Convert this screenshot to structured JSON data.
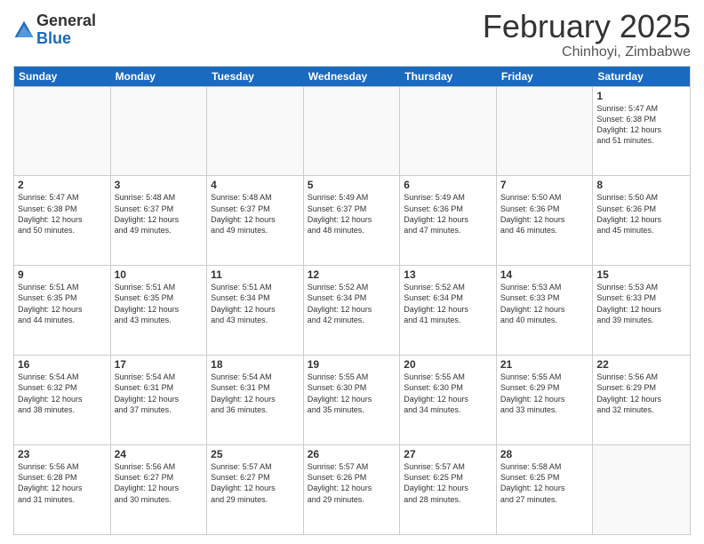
{
  "logo": {
    "general": "General",
    "blue": "Blue"
  },
  "title": "February 2025",
  "location": "Chinhoyi, Zimbabwe",
  "weekdays": [
    "Sunday",
    "Monday",
    "Tuesday",
    "Wednesday",
    "Thursday",
    "Friday",
    "Saturday"
  ],
  "weeks": [
    [
      {
        "day": "",
        "info": ""
      },
      {
        "day": "",
        "info": ""
      },
      {
        "day": "",
        "info": ""
      },
      {
        "day": "",
        "info": ""
      },
      {
        "day": "",
        "info": ""
      },
      {
        "day": "",
        "info": ""
      },
      {
        "day": "1",
        "info": "Sunrise: 5:47 AM\nSunset: 6:38 PM\nDaylight: 12 hours\nand 51 minutes."
      }
    ],
    [
      {
        "day": "2",
        "info": "Sunrise: 5:47 AM\nSunset: 6:38 PM\nDaylight: 12 hours\nand 50 minutes."
      },
      {
        "day": "3",
        "info": "Sunrise: 5:48 AM\nSunset: 6:37 PM\nDaylight: 12 hours\nand 49 minutes."
      },
      {
        "day": "4",
        "info": "Sunrise: 5:48 AM\nSunset: 6:37 PM\nDaylight: 12 hours\nand 49 minutes."
      },
      {
        "day": "5",
        "info": "Sunrise: 5:49 AM\nSunset: 6:37 PM\nDaylight: 12 hours\nand 48 minutes."
      },
      {
        "day": "6",
        "info": "Sunrise: 5:49 AM\nSunset: 6:36 PM\nDaylight: 12 hours\nand 47 minutes."
      },
      {
        "day": "7",
        "info": "Sunrise: 5:50 AM\nSunset: 6:36 PM\nDaylight: 12 hours\nand 46 minutes."
      },
      {
        "day": "8",
        "info": "Sunrise: 5:50 AM\nSunset: 6:36 PM\nDaylight: 12 hours\nand 45 minutes."
      }
    ],
    [
      {
        "day": "9",
        "info": "Sunrise: 5:51 AM\nSunset: 6:35 PM\nDaylight: 12 hours\nand 44 minutes."
      },
      {
        "day": "10",
        "info": "Sunrise: 5:51 AM\nSunset: 6:35 PM\nDaylight: 12 hours\nand 43 minutes."
      },
      {
        "day": "11",
        "info": "Sunrise: 5:51 AM\nSunset: 6:34 PM\nDaylight: 12 hours\nand 43 minutes."
      },
      {
        "day": "12",
        "info": "Sunrise: 5:52 AM\nSunset: 6:34 PM\nDaylight: 12 hours\nand 42 minutes."
      },
      {
        "day": "13",
        "info": "Sunrise: 5:52 AM\nSunset: 6:34 PM\nDaylight: 12 hours\nand 41 minutes."
      },
      {
        "day": "14",
        "info": "Sunrise: 5:53 AM\nSunset: 6:33 PM\nDaylight: 12 hours\nand 40 minutes."
      },
      {
        "day": "15",
        "info": "Sunrise: 5:53 AM\nSunset: 6:33 PM\nDaylight: 12 hours\nand 39 minutes."
      }
    ],
    [
      {
        "day": "16",
        "info": "Sunrise: 5:54 AM\nSunset: 6:32 PM\nDaylight: 12 hours\nand 38 minutes."
      },
      {
        "day": "17",
        "info": "Sunrise: 5:54 AM\nSunset: 6:31 PM\nDaylight: 12 hours\nand 37 minutes."
      },
      {
        "day": "18",
        "info": "Sunrise: 5:54 AM\nSunset: 6:31 PM\nDaylight: 12 hours\nand 36 minutes."
      },
      {
        "day": "19",
        "info": "Sunrise: 5:55 AM\nSunset: 6:30 PM\nDaylight: 12 hours\nand 35 minutes."
      },
      {
        "day": "20",
        "info": "Sunrise: 5:55 AM\nSunset: 6:30 PM\nDaylight: 12 hours\nand 34 minutes."
      },
      {
        "day": "21",
        "info": "Sunrise: 5:55 AM\nSunset: 6:29 PM\nDaylight: 12 hours\nand 33 minutes."
      },
      {
        "day": "22",
        "info": "Sunrise: 5:56 AM\nSunset: 6:29 PM\nDaylight: 12 hours\nand 32 minutes."
      }
    ],
    [
      {
        "day": "23",
        "info": "Sunrise: 5:56 AM\nSunset: 6:28 PM\nDaylight: 12 hours\nand 31 minutes."
      },
      {
        "day": "24",
        "info": "Sunrise: 5:56 AM\nSunset: 6:27 PM\nDaylight: 12 hours\nand 30 minutes."
      },
      {
        "day": "25",
        "info": "Sunrise: 5:57 AM\nSunset: 6:27 PM\nDaylight: 12 hours\nand 29 minutes."
      },
      {
        "day": "26",
        "info": "Sunrise: 5:57 AM\nSunset: 6:26 PM\nDaylight: 12 hours\nand 29 minutes."
      },
      {
        "day": "27",
        "info": "Sunrise: 5:57 AM\nSunset: 6:25 PM\nDaylight: 12 hours\nand 28 minutes."
      },
      {
        "day": "28",
        "info": "Sunrise: 5:58 AM\nSunset: 6:25 PM\nDaylight: 12 hours\nand 27 minutes."
      },
      {
        "day": "",
        "info": ""
      }
    ]
  ]
}
